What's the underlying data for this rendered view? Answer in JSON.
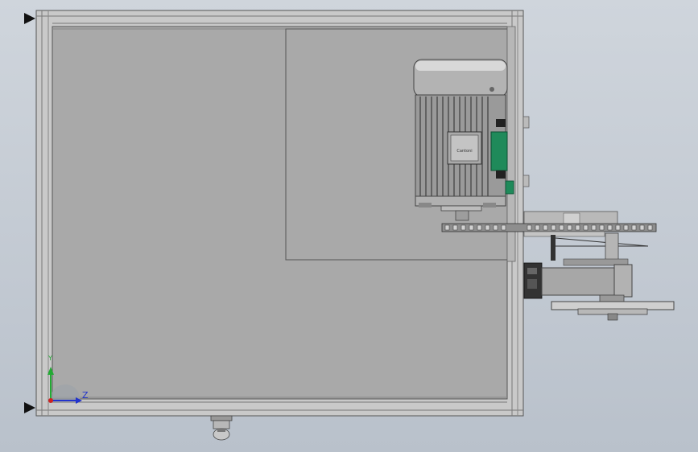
{
  "viewport": {
    "background_top": "#cfd5dc",
    "background_bottom": "#b9c1cb"
  },
  "triad": {
    "z_label": "Z",
    "y_label": "Y",
    "x_axis_color": "#cc2222",
    "y_axis_color": "#22aa33",
    "z_axis_color": "#2233cc"
  },
  "model": {
    "frame_panel_color": "#a9a9a9",
    "frame_profile_color": "#c8c8c8",
    "motor_color": "#a2a2a2",
    "terminal_box_color": "#1f8a5a",
    "motor_brand": "Cantoni"
  },
  "icons": [
    "frame-arrow-icon",
    "triad-icon"
  ]
}
